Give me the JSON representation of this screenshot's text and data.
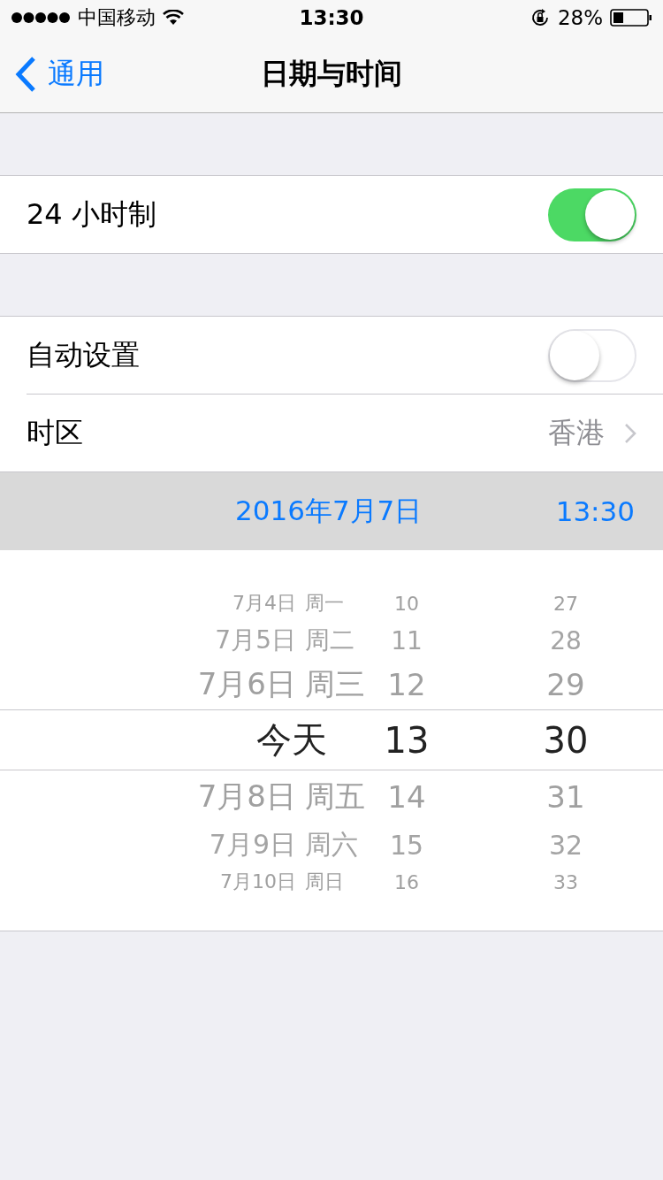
{
  "status_bar": {
    "carrier": "中国移动",
    "time": "13:30",
    "battery": "28%"
  },
  "nav": {
    "back": "通用",
    "title": "日期与时间"
  },
  "sections": [
    {
      "rows": [
        {
          "kind": "toggle",
          "label": "24 小时制",
          "on": true
        }
      ]
    },
    {
      "rows": [
        {
          "kind": "toggle",
          "label": "自动设置",
          "on": false
        },
        {
          "kind": "link",
          "label": "时区",
          "value": "香港"
        }
      ]
    }
  ],
  "current": {
    "date": "2016年7月7日",
    "time": "13:30"
  },
  "picker": {
    "rows": [
      {
        "date": "7月4日",
        "weekday": "周一",
        "hour": "10",
        "minute": "27",
        "selected": false
      },
      {
        "date": "7月5日",
        "weekday": "周二",
        "hour": "11",
        "minute": "28",
        "selected": false
      },
      {
        "date": "7月6日",
        "weekday": "周三",
        "hour": "12",
        "minute": "29",
        "selected": false
      },
      {
        "date": "今天",
        "hour": "13",
        "minute": "30",
        "selected": true
      },
      {
        "date": "7月8日",
        "weekday": "周五",
        "hour": "14",
        "minute": "31",
        "selected": false
      },
      {
        "date": "7月9日",
        "weekday": "周六",
        "hour": "15",
        "minute": "32",
        "selected": false
      },
      {
        "date": "7月10日",
        "weekday": "周日",
        "hour": "16",
        "minute": "33",
        "selected": false
      }
    ]
  }
}
